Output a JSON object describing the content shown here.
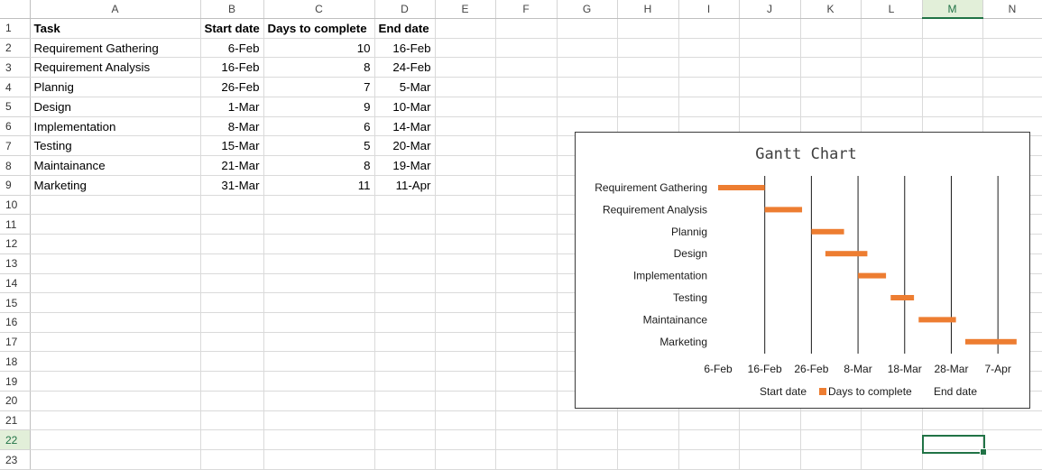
{
  "column_headers": [
    "A",
    "B",
    "C",
    "D",
    "E",
    "F",
    "G",
    "H",
    "I",
    "J",
    "K",
    "L",
    "M",
    "N"
  ],
  "row_numbers": [
    "1",
    "2",
    "3",
    "4",
    "5",
    "6",
    "7",
    "8",
    "9",
    "10",
    "11",
    "12",
    "13",
    "14",
    "15",
    "16",
    "17",
    "18",
    "19",
    "20",
    "21",
    "22",
    "23"
  ],
  "active_cell": {
    "column": "M",
    "row": "22"
  },
  "table": {
    "headers": [
      "Task",
      "Start date",
      "Days to complete",
      "End date"
    ],
    "rows": [
      [
        "Requirement Gathering",
        "6-Feb",
        "10",
        "16-Feb"
      ],
      [
        "Requirement Analysis",
        "16-Feb",
        "8",
        "24-Feb"
      ],
      [
        "Plannig",
        "26-Feb",
        "7",
        "5-Mar"
      ],
      [
        "Design",
        "1-Mar",
        "9",
        "10-Mar"
      ],
      [
        "Implementation",
        "8-Mar",
        "6",
        "14-Mar"
      ],
      [
        "Testing",
        "15-Mar",
        "5",
        "20-Mar"
      ],
      [
        "Maintainance",
        "21-Mar",
        "8",
        "19-Mar"
      ],
      [
        "Marketing",
        "31-Mar",
        "11",
        "11-Apr"
      ]
    ]
  },
  "chart_data": {
    "type": "bar",
    "subtype": "gantt (stacked horizontal bar, start series hidden)",
    "title": "Gantt Chart",
    "categories": [
      "Requirement Gathering",
      "Requirement Analysis",
      "Plannig",
      "Design",
      "Implementation",
      "Testing",
      "Maintainance",
      "Marketing"
    ],
    "series": [
      {
        "name": "Start date",
        "values": [
          "6-Feb",
          "16-Feb",
          "26-Feb",
          "1-Mar",
          "8-Mar",
          "15-Mar",
          "21-Mar",
          "31-Mar"
        ],
        "visible": false
      },
      {
        "name": "Days to complete",
        "values": [
          10,
          8,
          7,
          9,
          6,
          5,
          8,
          11
        ],
        "color": "#ed7d31"
      },
      {
        "name": "End date",
        "values": [
          "16-Feb",
          "24-Feb",
          "5-Mar",
          "10-Mar",
          "14-Mar",
          "20-Mar",
          "19-Mar",
          "11-Apr"
        ],
        "visible": false
      }
    ],
    "x_tick_labels": [
      "6-Feb",
      "16-Feb",
      "26-Feb",
      "8-Mar",
      "18-Mar",
      "28-Mar",
      "7-Apr"
    ],
    "x_tick_days": [
      0,
      10,
      20,
      30,
      40,
      50,
      60
    ],
    "start_days": [
      0,
      10,
      20,
      23,
      30,
      37,
      43,
      53
    ],
    "xlim": [
      0,
      65
    ],
    "vertical_gridlines": true,
    "legend_placement": "bottom",
    "bar_color": "#ed7d31"
  }
}
